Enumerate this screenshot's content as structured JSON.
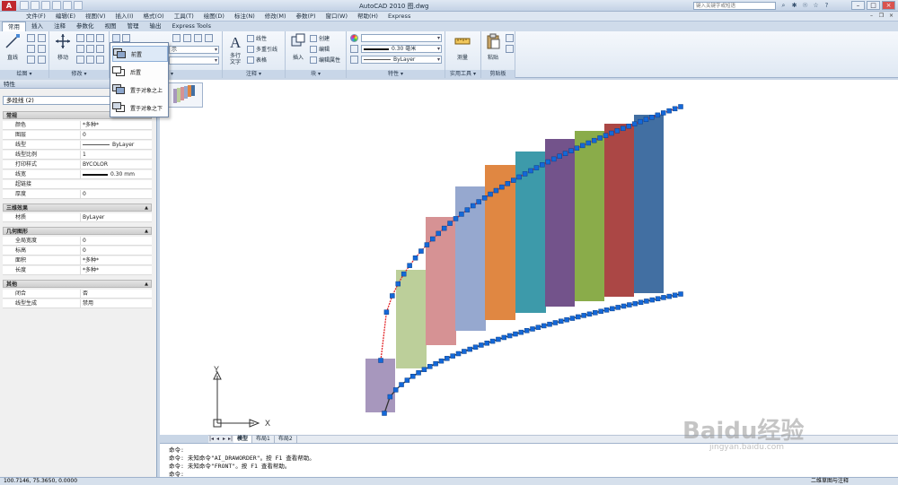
{
  "titlebar": {
    "logo": "A",
    "title": "AutoCAD 2010    图.dwg",
    "search_placeholder": "键入关键字或短语"
  },
  "menubar": {
    "items": [
      "文件(F)",
      "编辑(E)",
      "视图(V)",
      "插入(I)",
      "格式(O)",
      "工具(T)",
      "绘图(D)",
      "标注(N)",
      "修改(M)",
      "参数(P)",
      "窗口(W)",
      "帮助(H)",
      "Express"
    ]
  },
  "ribbon_tabs": {
    "items": [
      "常用",
      "插入",
      "注释",
      "参数化",
      "视图",
      "管理",
      "输出",
      "Express Tools"
    ],
    "active": "常用"
  },
  "ribbon": {
    "draw_panel": {
      "title": "绘图 ▾",
      "line_label": "直线"
    },
    "modify_panel": {
      "title": "修改 ▾",
      "move_label": "移动"
    },
    "layer_panel": {
      "title": "图层 ▾",
      "combo_value": "示"
    },
    "annotation_panel": {
      "title": "注释 ▾",
      "mtext_label": "多行\n文字",
      "linear_label": "线性",
      "multileader_label": "多重引线",
      "table_label": "表格"
    },
    "block_panel": {
      "title": "块 ▾",
      "insert_label": "插入",
      "create_label": "创建",
      "edit_label": "编辑",
      "edit_attr_label": "编辑属性"
    },
    "properties_panel": {
      "title": "特性 ▾",
      "lineweight_value": "0.30 毫米",
      "linetype_value": "ByLayer"
    },
    "utilities_panel": {
      "title": "实用工具 ▾",
      "measure_label": "测量"
    },
    "clipboard_panel": {
      "title": "剪贴板",
      "paste_label": "粘贴"
    }
  },
  "draw_order_menu": {
    "items": [
      "前置",
      "后置",
      "置于对象之上",
      "置于对象之下"
    ],
    "active": "前置"
  },
  "properties": {
    "header": "特性",
    "selection": "多段线 (2)",
    "sections": [
      {
        "title": "常规",
        "rows": [
          {
            "key": "颜色",
            "value": "*多种*"
          },
          {
            "key": "图层",
            "value": "0"
          },
          {
            "key": "线型",
            "value": "ByLayer"
          },
          {
            "key": "线型比例",
            "value": "1"
          },
          {
            "key": "打印样式",
            "value": "BYCOLOR"
          },
          {
            "key": "线宽",
            "value": "0.30 mm"
          },
          {
            "key": "超链接",
            "value": ""
          },
          {
            "key": "厚度",
            "value": "0"
          }
        ]
      },
      {
        "title": "三维效果",
        "rows": [
          {
            "key": "材质",
            "value": "ByLayer"
          }
        ]
      },
      {
        "title": "几何图形",
        "rows": [
          {
            "key": "全局宽度",
            "value": "0"
          },
          {
            "key": "标高",
            "value": "0"
          },
          {
            "key": "面积",
            "value": "*多种*"
          },
          {
            "key": "长度",
            "value": "*多种*"
          }
        ]
      },
      {
        "title": "其他",
        "rows": [
          {
            "key": "闭合",
            "value": "否"
          },
          {
            "key": "线型生成",
            "value": "禁用"
          }
        ]
      }
    ]
  },
  "drawing": {
    "axis_x": "X",
    "axis_y": "Y",
    "bar_colors": [
      "#a797bd",
      "#bccf9a",
      "#d69294",
      "#96a8cf",
      "#e08742",
      "#3d9aaa",
      "#73538b",
      "#8aac4a",
      "#ab4745",
      "#426fa2"
    ],
    "grip_color": "#1468d8",
    "curve_color": "#e3262a"
  },
  "layout_tabs": {
    "items": [
      "模型",
      "布局1",
      "布局2"
    ],
    "active": "模型"
  },
  "command_line": {
    "lines": [
      "命令:",
      "命令: 未知命令\"AI_DRAWORDER\"。按 F1 查看帮助。",
      "命令: 未知命令\"FRONT\"。按 F1 查看帮助。",
      "命令:"
    ]
  },
  "statusbar": {
    "coordinates": "100.7146,  75.3650,  0.0000",
    "workspace": "二维草图与注释"
  },
  "watermark": {
    "text": "Baidu经验",
    "sub": "jingyan.baidu.com"
  }
}
